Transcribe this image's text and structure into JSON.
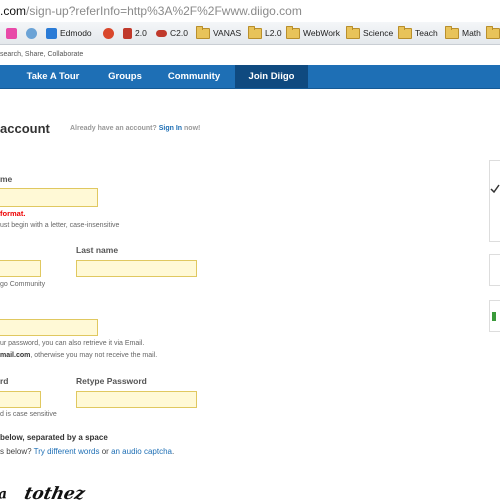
{
  "address_bar": {
    "host": ".com",
    "path": "/sign-up?referInfo=http%3A%2F%2Fwww.diigo.com"
  },
  "bookmarks": [
    {
      "label": "",
      "icon": "diigo-icon",
      "color": "#e84aa8"
    },
    {
      "label": "",
      "icon": "globe-icon",
      "color": "#6ba3d6"
    },
    {
      "label": "Edmodo",
      "icon": "edmodo-icon",
      "color": "#2a7bd6"
    },
    {
      "label": "",
      "icon": "record-icon",
      "color": "#d9472b"
    },
    {
      "label": "2.0",
      "icon": "plant-icon",
      "color": "#c0392b"
    },
    {
      "label": "C2.0",
      "icon": "cloud-icon",
      "color": "#c0392b"
    },
    {
      "label": "VANAS",
      "icon": "folder-icon"
    },
    {
      "label": "L2.0",
      "icon": "folder-icon"
    },
    {
      "label": "WebWork",
      "icon": "folder-icon"
    },
    {
      "label": "Science",
      "icon": "folder-icon"
    },
    {
      "label": "Teach",
      "icon": "folder-icon"
    },
    {
      "label": "Math",
      "icon": "folder-icon"
    },
    {
      "label": "",
      "icon": "folder-icon"
    }
  ],
  "tagline": "search, Share, Collaborate",
  "nav": {
    "items": [
      {
        "label": "Take A Tour"
      },
      {
        "label": "Groups"
      },
      {
        "label": "Community"
      },
      {
        "label": "Join Diigo"
      }
    ]
  },
  "form": {
    "heading": "account",
    "aside_prefix": "Already have an account?",
    "aside_link": "Sign In",
    "aside_suffix": "now!",
    "username_label": "me",
    "username_error": "format.",
    "username_hint": "ust begin with a letter, case-insensitive",
    "first_name_hint": "go Community",
    "last_name_label": "Last name",
    "email_hint_1": "ur password, you can also retrieve it via Email.",
    "email_hint_2_bold": "mail.com",
    "email_hint_2_rest": ", otherwise you may not receive the mail.",
    "password_label": "rd",
    "retype_label": "Retype Password",
    "password_hint": "d is case sensitive",
    "captcha_label_bold": "below,",
    "captcha_label_rest": "separated by a space",
    "captcha_q_prefix": "s below?",
    "captcha_link_1": "Try different words",
    "captcha_or": "or",
    "captcha_link_2": "an audio captcha",
    "captcha_end": ".",
    "captcha_words": "tothez",
    "fields": {
      "username": "",
      "first_name": "",
      "last_name": "",
      "email": "",
      "password": "",
      "retype_password": ""
    }
  },
  "colors": {
    "nav_bg": "#1e6fb5",
    "nav_active": "#0f4a80",
    "field_bg": "#fff9d6",
    "field_border": "#e0c860",
    "error": "#e00000",
    "link": "#1e6fb5"
  }
}
